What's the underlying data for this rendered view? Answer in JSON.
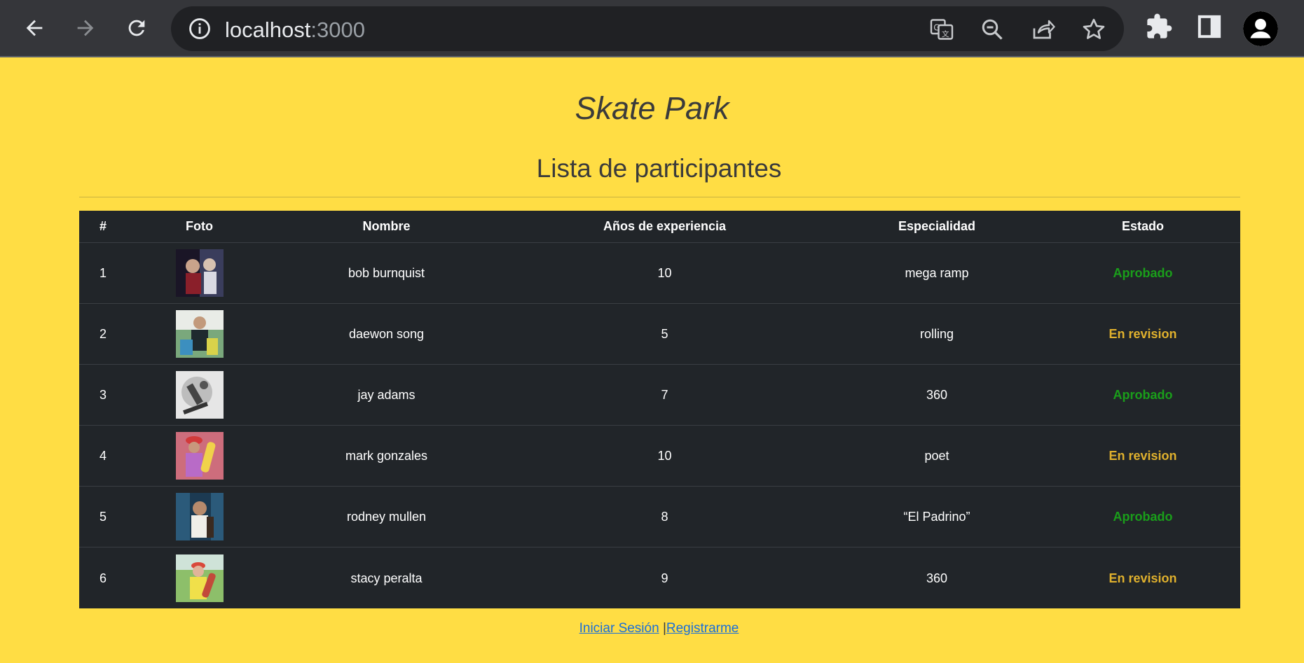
{
  "browser": {
    "url_host": "localhost",
    "url_port": ":3000"
  },
  "page": {
    "title": "Skate Park",
    "subtitle": "Lista de participantes"
  },
  "table": {
    "headers": [
      "#",
      "Foto",
      "Nombre",
      "Años de experiencia",
      "Especialidad",
      "Estado"
    ],
    "rows": [
      {
        "num": "1",
        "name": "bob burnquist",
        "years": "10",
        "specialty": "mega ramp",
        "status": "Aprobado",
        "status_kind": "ok"
      },
      {
        "num": "2",
        "name": "daewon song",
        "years": "5",
        "specialty": "rolling",
        "status": "En revision",
        "status_kind": "rev"
      },
      {
        "num": "3",
        "name": "jay adams",
        "years": "7",
        "specialty": "360",
        "status": "Aprobado",
        "status_kind": "ok"
      },
      {
        "num": "4",
        "name": "mark gonzales",
        "years": "10",
        "specialty": "poet",
        "status": "En revision",
        "status_kind": "rev"
      },
      {
        "num": "5",
        "name": "rodney mullen",
        "years": "8",
        "specialty": "“El Padrino”",
        "status": "Aprobado",
        "status_kind": "ok"
      },
      {
        "num": "6",
        "name": "stacy peralta",
        "years": "9",
        "specialty": "360",
        "status": "En revision",
        "status_kind": "rev"
      }
    ]
  },
  "footer": {
    "login": "Iniciar Sesión",
    "separator": "|",
    "register": "Registrarme"
  },
  "colors": {
    "page_bg": "#ffdd44",
    "table_bg": "#212529",
    "status_ok": "#1a9e1a",
    "status_review": "#e0b12d",
    "link": "#1a6fd9"
  }
}
